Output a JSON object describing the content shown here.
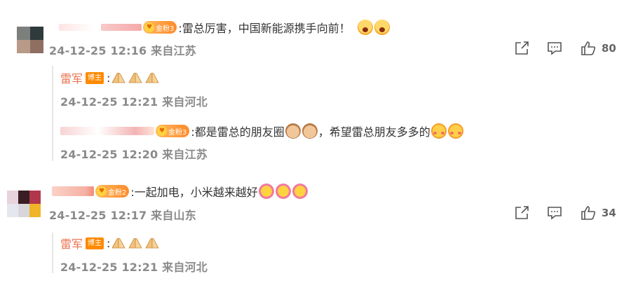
{
  "comments": [
    {
      "fan_badge": "金粉3",
      "text": ":雷总厉害，中国新能源携手向前！",
      "meta": "24-12-25 12:16 来自江苏",
      "likes": "80",
      "avatar_colors": [
        "#7c7f7c",
        "#2f3a3c",
        "#b89a88",
        "#8e6f62"
      ],
      "replies": [
        {
          "author": "雷军",
          "badge": "博主",
          "text": ":",
          "meta": "24-12-25 12:21 来自河北"
        },
        {
          "fan_badge": "金粉3",
          "text": ":都是雷总的朋友圈",
          "text2": "，希望雷总朋友多多的",
          "meta": "24-12-25 12:20 来自江苏"
        }
      ]
    },
    {
      "fan_badge": "金粉2",
      "text": ":一起加电，小米越来越好",
      "meta": "24-12-25 12:17 来自山东",
      "likes": "34",
      "avatar_colors": [
        "#e8d3dc",
        "#3a1e24",
        "#b0374c",
        "#e6e6ee",
        "#d9d6db",
        "#f0b429"
      ],
      "replies": [
        {
          "author": "雷军",
          "badge": "博主",
          "text": ":",
          "meta": "24-12-25 12:21 来自河北"
        }
      ]
    }
  ]
}
